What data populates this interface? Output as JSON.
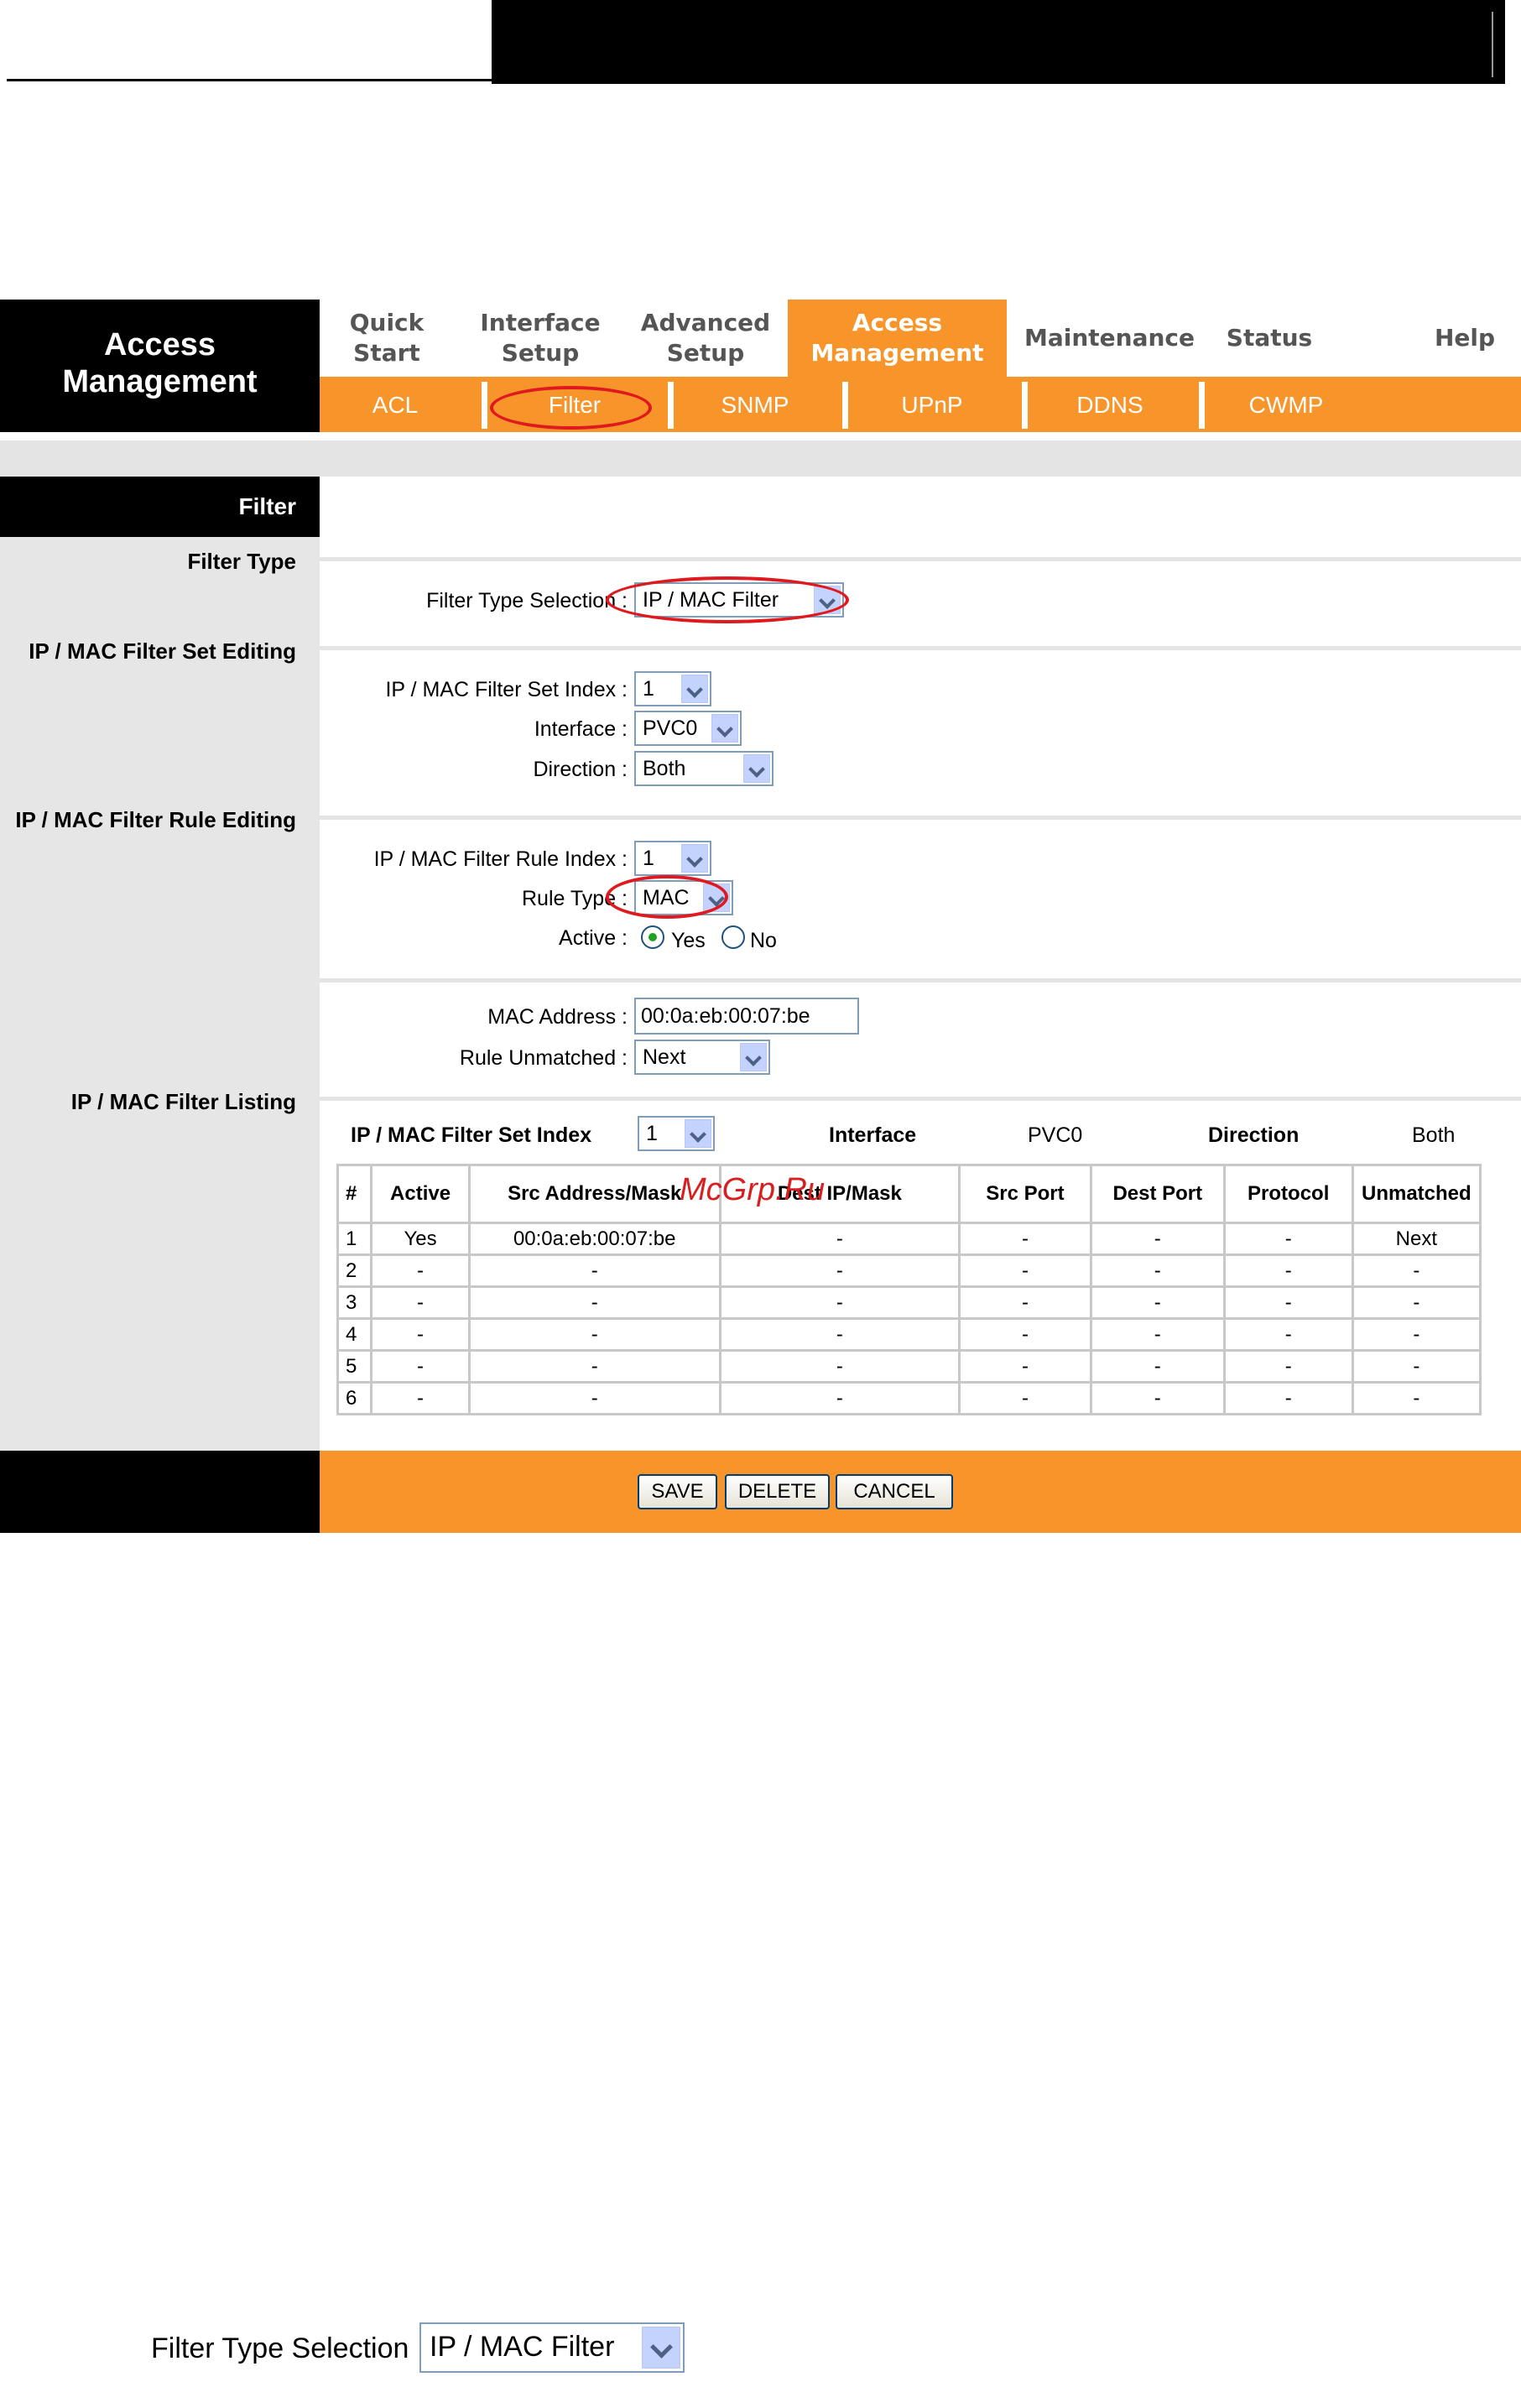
{
  "header": {
    "brand_line1": "Access",
    "brand_line2": "Management"
  },
  "nav": {
    "items": [
      {
        "line1": "Quick",
        "line2": "Start"
      },
      {
        "line1": "Interface",
        "line2": "Setup"
      },
      {
        "line1": "Advanced",
        "line2": "Setup"
      },
      {
        "line1": "Access",
        "line2": "Management"
      },
      {
        "line1": "Maintenance",
        "line2": ""
      },
      {
        "line1": "Status",
        "line2": ""
      },
      {
        "line1": "Help",
        "line2": ""
      }
    ],
    "active_index": 3,
    "sub_items": [
      "ACL",
      "Filter",
      "SNMP",
      "UPnP",
      "DDNS",
      "CWMP"
    ],
    "active_sub": "Filter"
  },
  "sidebar": {
    "section_title": "Filter",
    "filter_type": "Filter Type",
    "set_editing": "IP / MAC Filter Set Editing",
    "rule_editing": "IP / MAC Filter Rule Editing",
    "listing": "IP / MAC Filter Listing"
  },
  "form": {
    "filter_type_label": "Filter Type Selection :",
    "filter_type_value": "IP / MAC Filter",
    "set_index_label": "IP / MAC Filter Set Index :",
    "set_index_value": "1",
    "interface_label": "Interface :",
    "interface_value": "PVC0",
    "direction_label": "Direction :",
    "direction_value": "Both",
    "rule_index_label": "IP / MAC Filter Rule Index :",
    "rule_index_value": "1",
    "rule_type_label": "Rule Type :",
    "rule_type_value": "MAC",
    "active_label": "Active :",
    "active_yes": "Yes",
    "active_no": "No",
    "mac_label": "MAC Address :",
    "mac_value": "00:0a:eb:00:07:be",
    "unmatched_label": "Rule Unmatched :",
    "unmatched_value": "Next"
  },
  "listing": {
    "set_index_label": "IP / MAC Filter Set Index",
    "set_index_value": "1",
    "interface_label": "Interface",
    "interface_value": "PVC0",
    "direction_label": "Direction",
    "direction_value": "Both",
    "columns": [
      "#",
      "Active",
      "Src Address/Mask",
      "Dest IP/Mask",
      "Src Port",
      "Dest Port",
      "Protocol",
      "Unmatched"
    ],
    "rows": [
      [
        "1",
        "Yes",
        "00:0a:eb:00:07:be",
        "-",
        "-",
        "-",
        "-",
        "Next"
      ],
      [
        "2",
        "-",
        "-",
        "-",
        "-",
        "-",
        "-",
        "-"
      ],
      [
        "3",
        "-",
        "-",
        "-",
        "-",
        "-",
        "-",
        "-"
      ],
      [
        "4",
        "-",
        "-",
        "-",
        "-",
        "-",
        "-",
        "-"
      ],
      [
        "5",
        "-",
        "-",
        "-",
        "-",
        "-",
        "-",
        "-"
      ],
      [
        "6",
        "-",
        "-",
        "-",
        "-",
        "-",
        "-",
        "-"
      ]
    ]
  },
  "buttons": {
    "save": "SAVE",
    "delete": "DELETE",
    "cancel": "CANCEL"
  },
  "watermark": "McGrp.Ru",
  "excerpt": {
    "label": "Filter Type Selection :",
    "value": "IP / MAC Filter"
  },
  "colors": {
    "accent": "#f7952b",
    "highlight": "#e0191f"
  }
}
